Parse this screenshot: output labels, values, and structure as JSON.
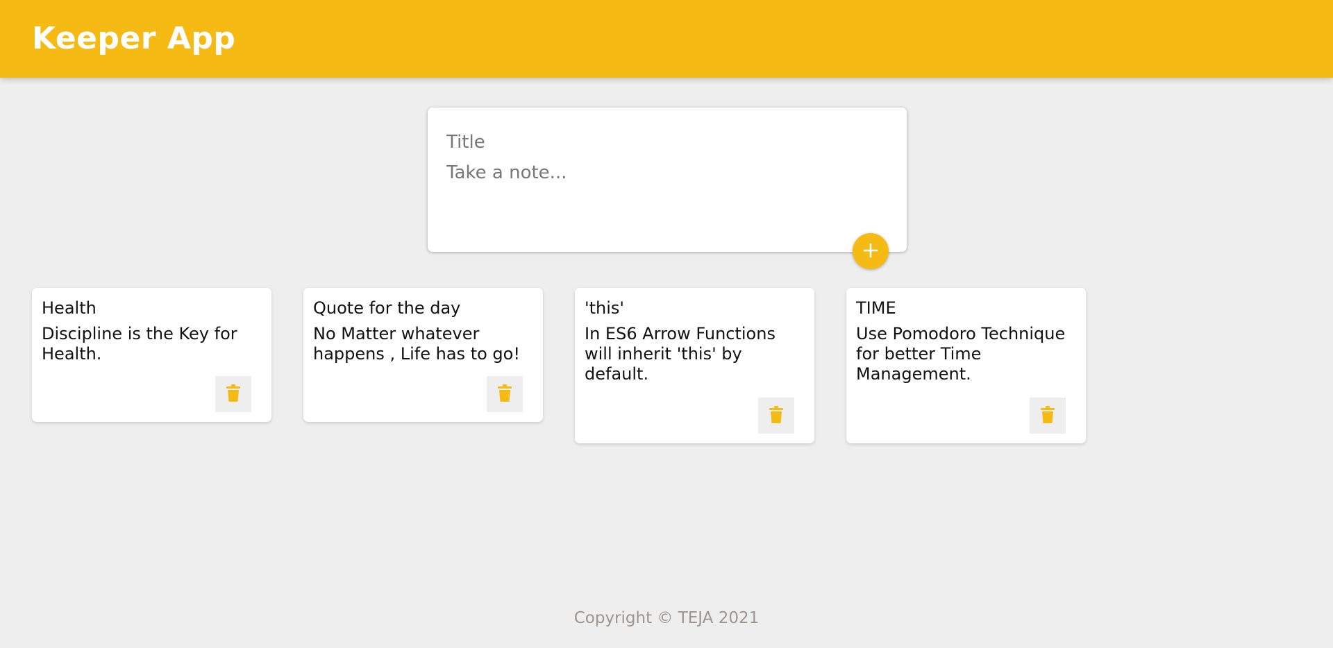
{
  "header": {
    "title": "Keeper App"
  },
  "create_note": {
    "title_placeholder": "Title",
    "content_placeholder": "Take a note...",
    "add_icon": "plus-icon"
  },
  "notes": [
    {
      "title": "Health",
      "content": "Discipline is the Key for Health.",
      "delete_icon": "trash-icon"
    },
    {
      "title": "Quote for the day",
      "content": "No Matter whatever happens , Life has to go!",
      "delete_icon": "trash-icon"
    },
    {
      "title": "'this'",
      "content": "In ES6 Arrow Functions will inherit 'this' by default.",
      "delete_icon": "trash-icon"
    },
    {
      "title": "TIME",
      "content": "Use Pomodoro Technique for better Time Management.",
      "delete_icon": "trash-icon"
    }
  ],
  "footer": {
    "copyright": "Copyright © TEJA 2021"
  },
  "colors": {
    "accent": "#f5ba13",
    "background": "#eeeeee",
    "card": "#ffffff",
    "footer_text": "#9b9691"
  }
}
